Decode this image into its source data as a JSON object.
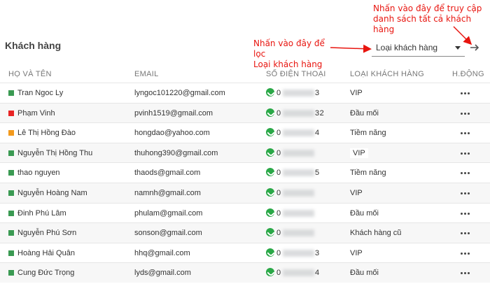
{
  "annotations": {
    "top": [
      "Nhấn vào đây để truy cập",
      "danh sách tất cả khách hàng"
    ],
    "filter": [
      "Nhấn vào đây để lọc",
      "Loại khách hàng"
    ]
  },
  "page_title": "Khách hàng",
  "filter": {
    "label": "Loại khách hàng"
  },
  "columns": {
    "name": "HỌ VÀ TÊN",
    "email": "EMAIL",
    "phone": "SỐ ĐIỆN THOẠI",
    "type": "LOẠI KHÁCH HÀNG",
    "action": "H.ĐỘNG"
  },
  "rows": [
    {
      "name": "Tran Ngoc Ly",
      "email": "lyngoc101220@gmail.com",
      "phone_start": "0",
      "phone_end": "3",
      "type": "VIP",
      "status_color": "#3a9a52"
    },
    {
      "name": "Phạm Vinh",
      "email": "pvinh1519@gmail.com",
      "phone_start": "0",
      "phone_end": "32",
      "type": "Đầu mối",
      "status_color": "#e82424"
    },
    {
      "name": "Lê Thị Hồng Đào",
      "email": "hongdao@yahoo.com",
      "phone_start": "0",
      "phone_end": "4",
      "type": "Tiềm năng",
      "status_color": "#f39a1d"
    },
    {
      "name": "Nguyễn Thị Hồng Thu",
      "email": "thuhong390@gmail.com",
      "phone_start": "0",
      "phone_end": "",
      "type": "VIP",
      "status_color": "#3a9a52"
    },
    {
      "name": "thao nguyen",
      "email": "thaods@gmail.com",
      "phone_start": "0",
      "phone_end": "5",
      "type": "Tiềm năng",
      "status_color": "#3a9a52"
    },
    {
      "name": "Nguyễn Hoàng Nam",
      "email": "namnh@gmail.com",
      "phone_start": "0",
      "phone_end": "",
      "type": "VIP",
      "status_color": "#3a9a52"
    },
    {
      "name": "Đinh Phú Lâm",
      "email": "phulam@gmail.com",
      "phone_start": "0",
      "phone_end": "",
      "type": "Đầu mối",
      "status_color": "#3a9a52"
    },
    {
      "name": "Nguyễn Phú Sơn",
      "email": "sonson@gmail.com",
      "phone_start": "0",
      "phone_end": "",
      "type": "Khách hàng cũ",
      "status_color": "#3a9a52"
    },
    {
      "name": "Hoàng Hải Quân",
      "email": "hhq@gmail.com",
      "phone_start": "0",
      "phone_end": "3",
      "type": "VIP",
      "status_color": "#3a9a52"
    },
    {
      "name": "Cung Đức Trọng",
      "email": "lyds@gmail.com",
      "phone_start": "0",
      "phone_end": "4",
      "type": "Đầu mối",
      "status_color": "#3a9a52"
    }
  ],
  "icons": {
    "phone": "phone-icon",
    "more": "more-icon",
    "link": "arrow-right-icon",
    "dropdown": "caret-down-icon"
  },
  "colors": {
    "annotation": "#e8150f",
    "phone_icon": "#2aa847"
  }
}
